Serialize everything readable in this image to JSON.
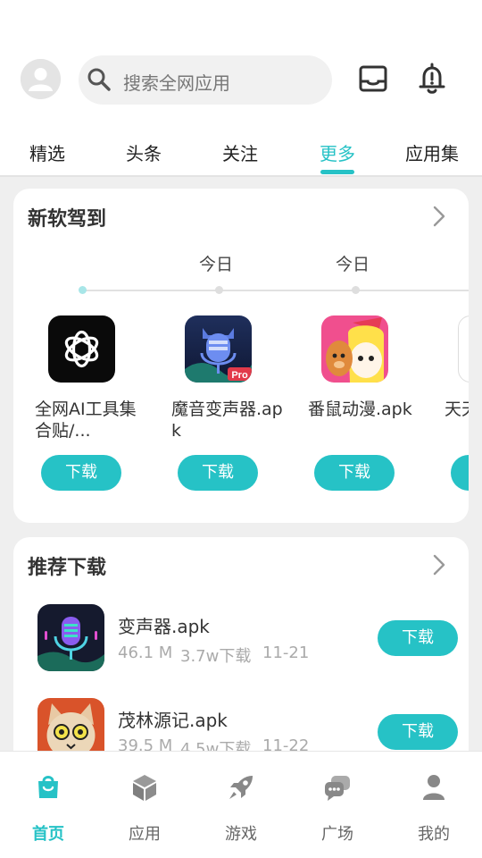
{
  "header": {
    "search_placeholder": "搜索全网应用",
    "avatar_icon": "user-avatar-icon",
    "inbox_icon": "inbox-icon",
    "bell_icon": "bell-alert-icon"
  },
  "tabs": [
    {
      "label": "精选",
      "active": false
    },
    {
      "label": "头条",
      "active": false
    },
    {
      "label": "关注",
      "active": false
    },
    {
      "label": "更多",
      "active": true
    },
    {
      "label": "应用集",
      "active": false
    }
  ],
  "new_apps": {
    "title": "新软驾到",
    "timeline_labels": [
      "今日",
      "今日"
    ],
    "apps": [
      {
        "name": "全网AI工具集合贴/...",
        "button": "下载",
        "icon": "openai-icon"
      },
      {
        "name": "魔音变声器.apk",
        "button": "下载",
        "icon": "voice-changer-pro-icon"
      },
      {
        "name": "番鼠动漫.apk",
        "button": "下载",
        "icon": "anime-app-icon"
      },
      {
        "name": "天天听.",
        "button": "下",
        "icon": "partial-app-icon"
      }
    ]
  },
  "recommended": {
    "title": "推荐下载",
    "items": [
      {
        "name": "变声器.apk",
        "size": "46.1 M",
        "downloads": "3.7w下载",
        "date": "11-21",
        "button": "下载",
        "icon": "microphone-app-icon"
      },
      {
        "name": "茂林源记.apk",
        "size": "39.5 M",
        "downloads": "4.5w下载",
        "date": "11-22",
        "button": "下载",
        "icon": "cat-game-icon"
      }
    ]
  },
  "bottom_nav": [
    {
      "label": "首页",
      "icon": "home-bag-icon",
      "active": true
    },
    {
      "label": "应用",
      "icon": "cube-icon",
      "active": false
    },
    {
      "label": "游戏",
      "icon": "rocket-icon",
      "active": false
    },
    {
      "label": "广场",
      "icon": "chat-bubbles-icon",
      "active": false
    },
    {
      "label": "我的",
      "icon": "person-icon",
      "active": false
    }
  ],
  "colors": {
    "accent": "#26c2c6",
    "background": "#efefef",
    "card": "#ffffff"
  }
}
